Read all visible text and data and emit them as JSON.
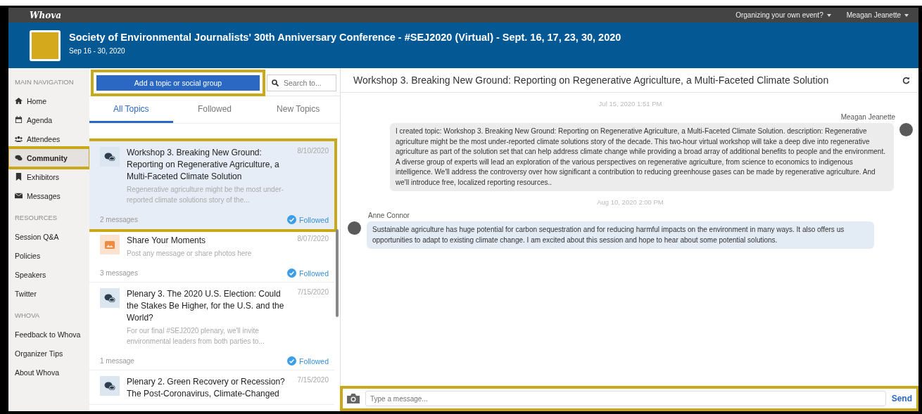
{
  "top_bar": {
    "logo": "Whova",
    "menus": [
      {
        "label": "Organizing your own event?"
      },
      {
        "label": "Meagan Jeanette"
      }
    ]
  },
  "event": {
    "title": "Society of Environmental Journalists' 30th Anniversary Conference - #SEJ2020 (Virtual) - Sept. 16, 17, 23, 30, 2020",
    "dates": "Sep 16 - 30, 2020"
  },
  "sidebar": {
    "sections": [
      {
        "heading": "MAIN NAVIGATION",
        "items": [
          {
            "label": "Home",
            "selected": false,
            "highlighted": false
          },
          {
            "label": "Agenda",
            "selected": false,
            "highlighted": false
          },
          {
            "label": "Attendees",
            "selected": false,
            "highlighted": false
          },
          {
            "label": "Community",
            "selected": true,
            "highlighted": true
          },
          {
            "label": "Exhibitors",
            "selected": false,
            "highlighted": false
          },
          {
            "label": "Messages",
            "selected": false,
            "highlighted": false
          }
        ]
      },
      {
        "heading": "RESOURCES",
        "items": [
          {
            "label": "Session Q&A",
            "selected": false,
            "highlighted": false
          },
          {
            "label": "Policies",
            "selected": false,
            "highlighted": false
          },
          {
            "label": "Speakers",
            "selected": false,
            "highlighted": false
          },
          {
            "label": "Twitter",
            "selected": false,
            "highlighted": false
          }
        ]
      },
      {
        "heading": "WHOVA",
        "items": [
          {
            "label": "Feedback to Whova",
            "selected": false,
            "highlighted": false
          },
          {
            "label": "Organizer Tips",
            "selected": false,
            "highlighted": false
          },
          {
            "label": "About Whova",
            "selected": false,
            "highlighted": false
          }
        ]
      }
    ]
  },
  "topics_panel": {
    "add_button": {
      "label": "Add a topic or social group",
      "highlighted": true
    },
    "search": {
      "placeholder": "Search to..."
    },
    "tabs": [
      {
        "label": "All Topics",
        "selected": true
      },
      {
        "label": "Followed",
        "selected": false
      },
      {
        "label": "New Topics",
        "selected": false
      }
    ],
    "topics": [
      {
        "kind": "discussion",
        "title": "Workshop 3. Breaking New Ground: Reporting on Regenerative Agriculture, a Multi-Faceted Climate Solution",
        "date": "8/10/2020",
        "preview": "Regenerative agriculture might be the most under-reported climate solutions story of the...",
        "count": "2 messages",
        "followed": true,
        "followed_label": "Followed",
        "selected": true,
        "highlighted": true
      },
      {
        "kind": "photo",
        "title": "Share Your Moments",
        "date": "8/07/2020",
        "preview": "Post any message or share photos here",
        "count": "3 messages",
        "followed": true,
        "followed_label": "Followed",
        "selected": false,
        "highlighted": false
      },
      {
        "kind": "discussion",
        "title": "Plenary 3. The 2020 U.S. Election: Could the Stakes Be Higher, for the U.S. and the World?",
        "date": "7/15/2020",
        "preview": "For our final #SEJ2020 plenary, we'll invite environmental leaders from both parties to...",
        "count": "1 message",
        "followed": true,
        "followed_label": "Followed",
        "selected": false,
        "highlighted": false
      },
      {
        "kind": "discussion",
        "title": "Plenary 2. Green Recovery or Recession? The Post-Coronavirus, Climate-Changed",
        "date": "7/15/2020",
        "selected": false,
        "highlighted": false
      }
    ]
  },
  "chat": {
    "title": "Workshop 3. Breaking New Ground: Reporting on Regenerative Agriculture, a Multi-Faceted Climate Solution",
    "items": [
      {
        "kind": "date",
        "text": "Jul 15, 2020 1:51 PM"
      },
      {
        "kind": "outgoing",
        "author": "Meagan Jeanette",
        "text": "I created topic: Workshop 3. Breaking New Ground: Reporting on Regenerative Agriculture, a Multi-Faceted Climate Solution. description: Regenerative agriculture might be the most under-reported climate solutions story of the decade. This two-hour virtual workshop will take a deep dive into regenerative agriculture as part of the solution set that can help address climate change while providing a broad array of additional benefits to people and the environment. A diverse group of experts will lead an exploration of the various perspectives on regenerative agriculture, from science to economics to indigenous intelligence. We'll address the controversy over how significant a contribution to reducing greenhouse gases can be made by regenerative agriculture. And we'll introduce free, localized reporting resources.."
      },
      {
        "kind": "date",
        "text": "Aug 10, 2020 2:00 PM"
      },
      {
        "kind": "incoming",
        "author": "Anne Connor",
        "text": "Sustainable agriculture has huge potential for carbon sequestration and for reducing harmful impacts on the environment in many ways. It also offers us opportunities to adapt to existing climate change. I am excited about this session and hope to hear about some potential solutions."
      }
    ],
    "composer": {
      "placeholder": "Type a message...",
      "send": "Send",
      "highlighted": true
    }
  }
}
